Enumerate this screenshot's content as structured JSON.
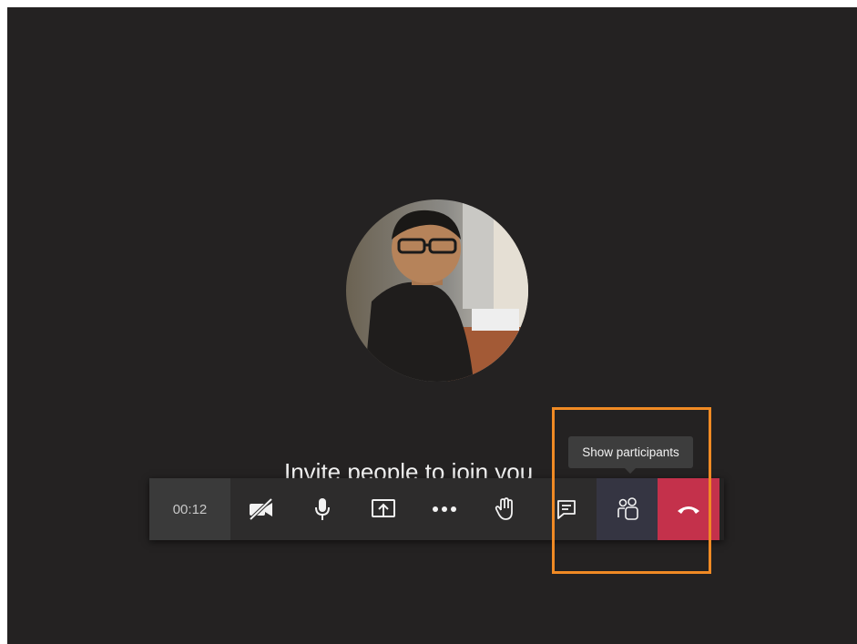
{
  "call": {
    "invite_text": "Invite people to join you",
    "timer": "00:12"
  },
  "toolbar": {
    "buttons": [
      {
        "name": "camera-off",
        "icon": "camera-off-icon"
      },
      {
        "name": "microphone",
        "icon": "microphone-icon"
      },
      {
        "name": "share",
        "icon": "share-screen-icon"
      },
      {
        "name": "more",
        "icon": "more-icon"
      },
      {
        "name": "raise-hand",
        "icon": "raise-hand-icon"
      },
      {
        "name": "chat",
        "icon": "chat-icon"
      },
      {
        "name": "participants",
        "icon": "participants-icon"
      },
      {
        "name": "hang-up",
        "icon": "phone-hangup-icon"
      }
    ]
  },
  "tooltip": {
    "text": "Show participants"
  },
  "colors": {
    "background": "#242222",
    "hangup": "#c4314b",
    "highlight": "#f08a24",
    "participants_active": "#353542"
  }
}
